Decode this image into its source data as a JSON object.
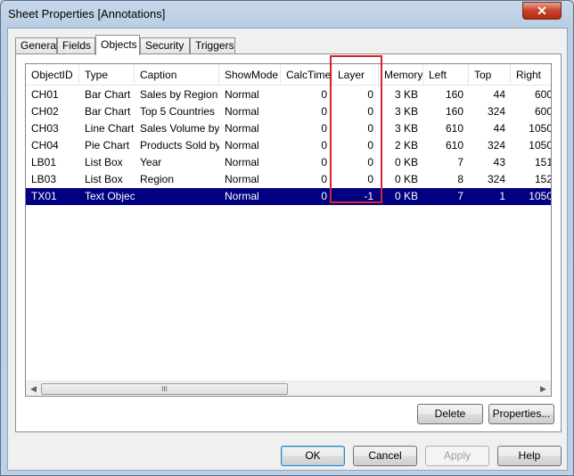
{
  "window": {
    "title": "Sheet Properties [Annotations]",
    "close_glyph": "✕"
  },
  "tabs": [
    {
      "label": "General"
    },
    {
      "label": "Fields"
    },
    {
      "label": "Objects",
      "active": true
    },
    {
      "label": "Security"
    },
    {
      "label": "Triggers"
    }
  ],
  "table": {
    "columns": [
      "ObjectID",
      "Type",
      "Caption",
      "ShowMode",
      "CalcTime",
      "Layer",
      "Memory",
      "Left",
      "Top",
      "Right"
    ],
    "rows": [
      [
        "CH01",
        "Bar Chart",
        "Sales by Region",
        "Normal",
        "0",
        "0",
        "3 KB",
        "160",
        "44",
        "600"
      ],
      [
        "CH02",
        "Bar Chart",
        "Top 5 Countries",
        "Normal",
        "0",
        "0",
        "3 KB",
        "160",
        "324",
        "600"
      ],
      [
        "CH03",
        "Line Chart",
        "Sales Volume by Y",
        "Normal",
        "0",
        "0",
        "3 KB",
        "610",
        "44",
        "1050"
      ],
      [
        "CH04",
        "Pie Chart",
        "Products Sold by",
        "Normal",
        "0",
        "0",
        "2 KB",
        "610",
        "324",
        "1050"
      ],
      [
        "LB01",
        "List Box",
        "Year",
        "Normal",
        "0",
        "0",
        "0 KB",
        "7",
        "43",
        "151"
      ],
      [
        "LB03",
        "List Box",
        "Region",
        "Normal",
        "0",
        "0",
        "0 KB",
        "8",
        "324",
        "152"
      ],
      [
        "TX01",
        "Text Object",
        "",
        "Normal",
        "0",
        "-1",
        "0 KB",
        "7",
        "1",
        "1050"
      ]
    ],
    "selected_row": 6,
    "scroll_thumb_grip": "III"
  },
  "buttons": {
    "delete": "Delete",
    "properties": "Properties...",
    "ok": "OK",
    "cancel": "Cancel",
    "apply": "Apply",
    "help": "Help"
  },
  "colors": {
    "selection": "#000080",
    "annotation_highlight": "#d9232d"
  }
}
